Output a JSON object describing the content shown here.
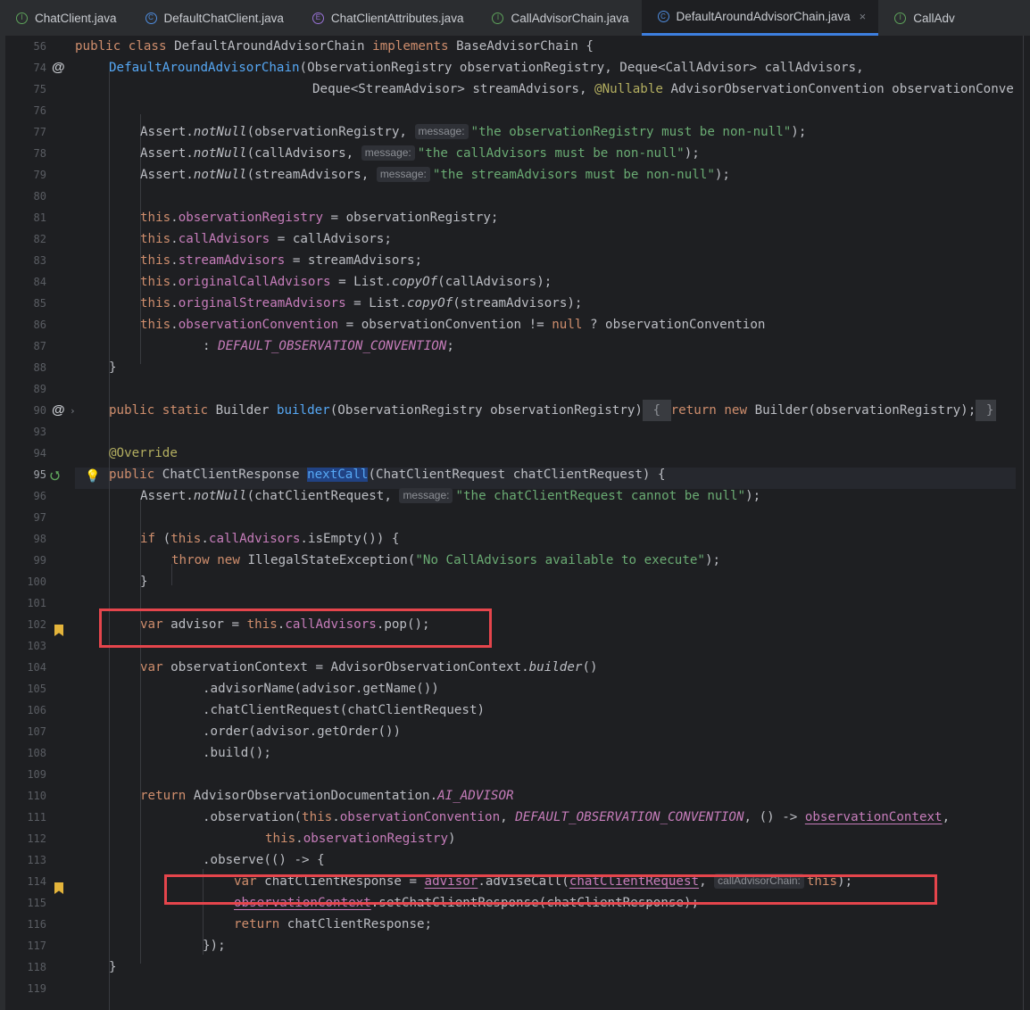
{
  "tabs": [
    {
      "label": "ChatClient.java",
      "kind": "interface",
      "active": false
    },
    {
      "label": "DefaultChatClient.java",
      "kind": "class",
      "active": false
    },
    {
      "label": "ChatClientAttributes.java",
      "kind": "enum",
      "active": false
    },
    {
      "label": "CallAdvisorChain.java",
      "kind": "interface",
      "active": false
    },
    {
      "label": "DefaultAroundAdvisorChain.java",
      "kind": "class",
      "active": true
    },
    {
      "label": "CallAdv",
      "kind": "interface",
      "active": false
    }
  ],
  "tab_close_glyph": "×",
  "tab_icon_letters": {
    "interface": "I",
    "class": "C",
    "enum": "E"
  },
  "line_numbers": [
    "56",
    "74",
    "75",
    "76",
    "77",
    "78",
    "79",
    "80",
    "81",
    "82",
    "83",
    "84",
    "85",
    "86",
    "87",
    "88",
    "89",
    "90",
    "93",
    "94",
    "95",
    "96",
    "97",
    "98",
    "99",
    "100",
    "101",
    "102",
    "103",
    "104",
    "105",
    "106",
    "107",
    "108",
    "109",
    "110",
    "111",
    "112",
    "113",
    "114",
    "115",
    "116",
    "117",
    "118",
    "119"
  ],
  "current_line": "95",
  "gutter_markers": {
    "at_icon": "@",
    "chevron_icon": "›",
    "override_icon": "⭯"
  },
  "inlay_hints": {
    "message": "message:",
    "call_advisor_chain": "callAdvisorChain:"
  },
  "highlight_boxes": [
    "line 102",
    "line 114"
  ],
  "code": {
    "l56": [
      "public",
      "class",
      "DefaultAroundAdvisorChain",
      "implements",
      "BaseAdvisorChain {"
    ],
    "l74": [
      "DefaultAroundAdvisorChain",
      "(ObservationRegistry observationRegistry, Deque<CallAdvisor> callAdvisors,"
    ],
    "l75": [
      "Deque<StreamAdvisor> streamAdvisors, ",
      "@Nullable",
      " AdvisorObservationConvention observationConve"
    ],
    "l77": [
      "Assert.",
      "notNull",
      "(observationRegistry, ",
      "\"the observationRegistry must be non-null\"",
      ");"
    ],
    "l78": [
      "Assert.",
      "notNull",
      "(callAdvisors, ",
      "\"the callAdvisors must be non-null\"",
      ");"
    ],
    "l79": [
      "Assert.",
      "notNull",
      "(streamAdvisors, ",
      "\"the streamAdvisors must be non-null\"",
      ");"
    ],
    "l81": [
      "this",
      ".",
      "observationRegistry",
      " = observationRegistry;"
    ],
    "l82": [
      "this",
      ".",
      "callAdvisors",
      " = callAdvisors;"
    ],
    "l83": [
      "this",
      ".",
      "streamAdvisors",
      " = streamAdvisors;"
    ],
    "l84": [
      "this",
      ".",
      "originalCallAdvisors",
      " = List.",
      "copyOf",
      "(callAdvisors);"
    ],
    "l85": [
      "this",
      ".",
      "originalStreamAdvisors",
      " = List.",
      "copyOf",
      "(streamAdvisors);"
    ],
    "l86": [
      "this",
      ".",
      "observationConvention",
      " = observationConvention != ",
      "null",
      " ? observationConvention"
    ],
    "l87": [
      ": ",
      "DEFAULT_OBSERVATION_CONVENTION",
      ";"
    ],
    "l88": [
      "}"
    ],
    "l90": [
      "public",
      "static",
      "Builder ",
      "builder",
      "(ObservationRegistry observationRegistry)",
      "{",
      "return",
      "new",
      "Builder(observationRegistry);",
      "}"
    ],
    "l94": [
      "@Override"
    ],
    "l95": [
      "public",
      "ChatClientResponse ",
      "nextCall",
      "(ChatClientRequest chatClientRequest) {"
    ],
    "l96": [
      "Assert.",
      "notNull",
      "(chatClientRequest, ",
      "\"the chatClientRequest cannot be null\"",
      ");"
    ],
    "l98": [
      "if",
      " (",
      "this",
      ".",
      "callAdvisors",
      ".isEmpty()) {"
    ],
    "l99": [
      "throw",
      "new",
      "IllegalStateException(",
      "\"No CallAdvisors available to execute\"",
      ");"
    ],
    "l100": [
      "}"
    ],
    "l102": [
      "var",
      "advisor = ",
      "this",
      ".",
      "callAdvisors",
      ".pop();"
    ],
    "l104": [
      "var",
      "observationContext = AdvisorObservationContext.",
      "builder",
      "()"
    ],
    "l105": [
      ".advisorName(advisor.getName())"
    ],
    "l106": [
      ".chatClientRequest(chatClientRequest)"
    ],
    "l107": [
      ".order(advisor.getOrder())"
    ],
    "l108": [
      ".build();"
    ],
    "l110": [
      "return",
      "AdvisorObservationDocumentation.",
      "AI_ADVISOR"
    ],
    "l111": [
      ".observation(",
      "this",
      ".",
      "observationConvention",
      ", ",
      "DEFAULT_OBSERVATION_CONVENTION",
      ", () -> ",
      "observationContext",
      ","
    ],
    "l112": [
      "this",
      ".",
      "observationRegistry",
      ")"
    ],
    "l113": [
      ".observe(() -> {"
    ],
    "l114": [
      "var",
      "chatClientResponse = ",
      "advisor",
      ".adviseCall(",
      "chatClientRequest",
      ", ",
      "this",
      ");"
    ],
    "l115": [
      "observationContext",
      ".setChatClientResponse(chatClientResponse);"
    ],
    "l116": [
      "return",
      "chatClientResponse;"
    ],
    "l117": [
      "});"
    ],
    "l118": [
      "}"
    ]
  }
}
